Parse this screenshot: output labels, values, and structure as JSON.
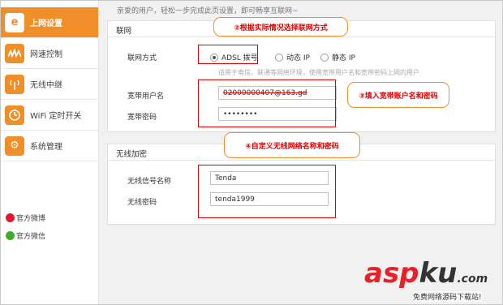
{
  "sidebar": {
    "items": [
      {
        "label": "上网设置",
        "icon": "e-globe-icon",
        "active": true
      },
      {
        "label": "网速控制",
        "icon": "speed-wave-icon",
        "active": false
      },
      {
        "label": "无线中继",
        "icon": "relay-antenna-icon",
        "active": false
      },
      {
        "label": "WiFi 定时开关",
        "icon": "wifi-clock-icon",
        "active": false
      },
      {
        "label": "系统管理",
        "icon": "gear-icon",
        "active": false
      }
    ],
    "weibo_label": "官方微博",
    "wechat_label": "官方微信"
  },
  "main": {
    "welcome": "亲爱的用户，轻松一步完成此页设置，即可畅享互联网~",
    "network_section": "联网",
    "connection_label": "联网方式",
    "connection_options": [
      "ADSL 拨号",
      "动态 IP",
      "静态 IP"
    ],
    "connection_selected": "ADSL 拨号",
    "hint": "适用于电信、联通等网络环境，使用宽带用户名和宽带密码上网的用户",
    "username_label": "宽带用户名",
    "username_value": "02000000407@163.gd",
    "password_label": "宽带密码",
    "password_value": "••••••••",
    "wireless_section": "无线加密",
    "ssid_label": "无线信号名称",
    "ssid_value": "Tenda",
    "wifi_password_label": "无线密码",
    "wifi_password_value": "tenda1999"
  },
  "annotations": {
    "step2": "②根据实际情况选择联网方式",
    "step3": "③填入宽带账户名和密码",
    "step4": "④自定义无线网络名称和密码"
  },
  "watermark": {
    "brand_a": "asp",
    "brand_b": "ku",
    "brand_c": ".com",
    "caption": "免费网络源码下载站!"
  },
  "colors": {
    "accent": "#f08f2a",
    "highlight": "#e00000"
  }
}
